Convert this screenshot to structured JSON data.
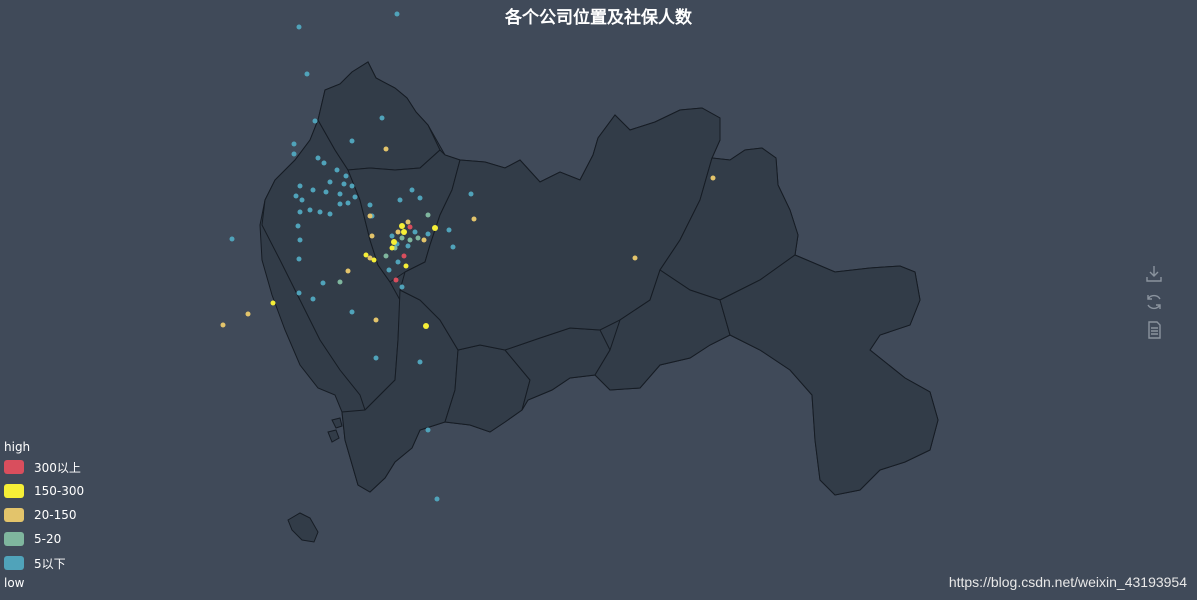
{
  "title": "各个公司位置及社保人数",
  "legend": {
    "high_label": "high",
    "low_label": "low",
    "items": [
      {
        "label": "300以上",
        "color": "#d94e5d"
      },
      {
        "label": "150-300",
        "color": "#f6ef37"
      },
      {
        "label": "20-150",
        "color": "#e3c46b"
      },
      {
        "label": "5-20",
        "color": "#7fb69e"
      },
      {
        "label": "5以下",
        "color": "#50a3ba"
      }
    ]
  },
  "toolbox": {
    "items": [
      {
        "name": "save-as-image",
        "icon": "download-icon"
      },
      {
        "name": "restore",
        "icon": "refresh-icon"
      },
      {
        "name": "data-view",
        "icon": "document-icon"
      }
    ]
  },
  "watermark": "https://blog.csdn.net/weixin_43193954",
  "colors": {
    "background": "#404a59",
    "region_fill": "#323c48",
    "region_border": "#111111"
  }
}
